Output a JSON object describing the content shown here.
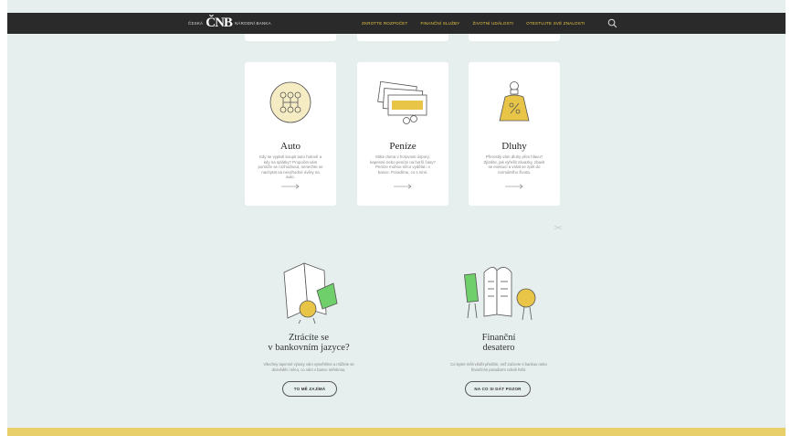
{
  "header": {
    "logo_left": "ČESKÁ",
    "logo_mark": "ČNB",
    "logo_right": "NÁRODNÍ BANKA",
    "nav": [
      "ZKROTTE ROZPOČET",
      "FINANČNÍ SLUŽBY",
      "ŽIVOTNÍ UDÁLOSTI",
      "OTESTUJTE SVÉ ZNALOSTI"
    ]
  },
  "cards": [
    {
      "title": "Auto",
      "text": "Kdy se vyplatí koupit auto hotově a kdy na splátky? Propočet vám pomůže se rozhodnout, nenechte se nachytat na nevýhodné úvěry na auto.",
      "icon": "gear-shift-icon"
    },
    {
      "title": "Peníze",
      "text": "Máte doma v hotovosti úspory, kapesné nebo peníze na horší časy? Peníze mohou něco vydělat i v bance. Poradíme, co s nimi.",
      "icon": "money-stack-icon"
    },
    {
      "title": "Dluhy",
      "text": "Přerostly vám dluhy přes hlavu? Zjistěte, jak vyřešit závazky, zbavit se exekucí a vrátit se zpět do normálního života.",
      "icon": "debt-weight-icon"
    }
  ],
  "features": [
    {
      "title_line1": "Ztrácíte se",
      "title_line2": "v bankovním jazyce?",
      "text": "Všechny tajemné výrazy vám vysvětlíme a můžete se dozvědět i něco, co vám v bance neřeknou.",
      "button": "TO MĚ ZAJÍMÁ"
    },
    {
      "title_line1": "Finanční",
      "title_line2": "desatero",
      "text": "Co byste měli vědět předtím, než začnete s bankou nebo finančním poradcem cokoli řešit.",
      "button": "NA CO SI DÁT POZOR"
    }
  ],
  "colors": {
    "header_bg": "#2a2a2a",
    "accent_yellow": "#e8c547",
    "page_bg": "#e6efed",
    "footer_band": "#e9cf6a"
  }
}
